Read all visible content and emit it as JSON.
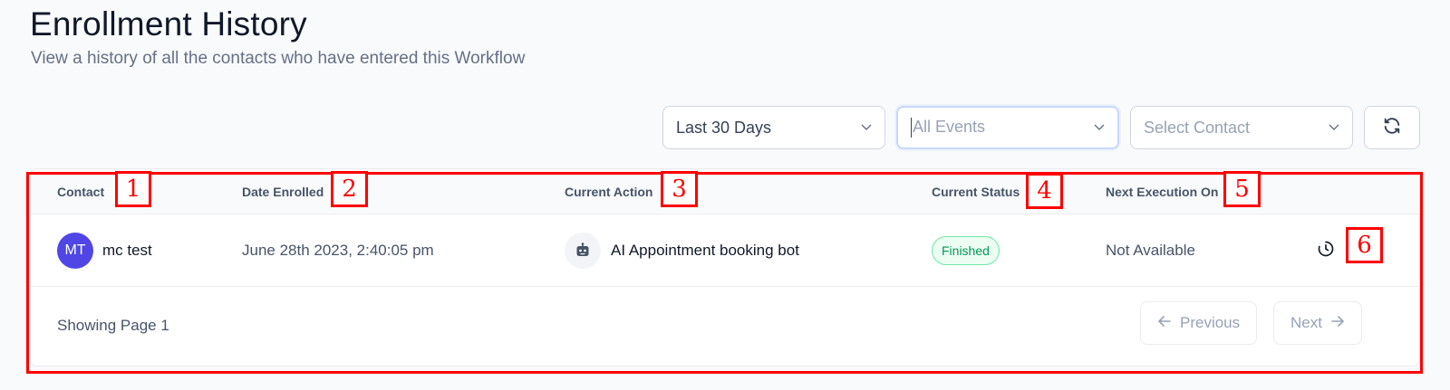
{
  "header": {
    "title": "Enrollment History",
    "subtitle": "View a history of all the contacts who have entered this Workflow"
  },
  "filters": {
    "date_range": "Last 30 Days",
    "events_placeholder": "All Events",
    "contact_placeholder": "Select Contact",
    "refresh_icon": "refresh-icon"
  },
  "table": {
    "columns": [
      "Contact",
      "Date Enrolled",
      "Current Action",
      "Current Status",
      "Next Execution On"
    ],
    "rows": [
      {
        "avatar_initials": "MT",
        "contact": "mc test",
        "date_enrolled": "June 28th 2023, 2:40:05 pm",
        "action_icon": "robot-icon",
        "current_action": "AI Appointment booking bot",
        "status": "Finished",
        "next_execution": "Not Available",
        "history_icon": "history-icon"
      }
    ]
  },
  "pagination": {
    "info": "Showing Page 1",
    "previous_label": "Previous",
    "next_label": "Next"
  },
  "annotations": [
    "1",
    "2",
    "3",
    "4",
    "5",
    "6"
  ],
  "colors": {
    "avatar": "#4f46e5",
    "status_text": "#039855",
    "status_border": "#6ce9a6",
    "annotation": "#ff0000"
  }
}
